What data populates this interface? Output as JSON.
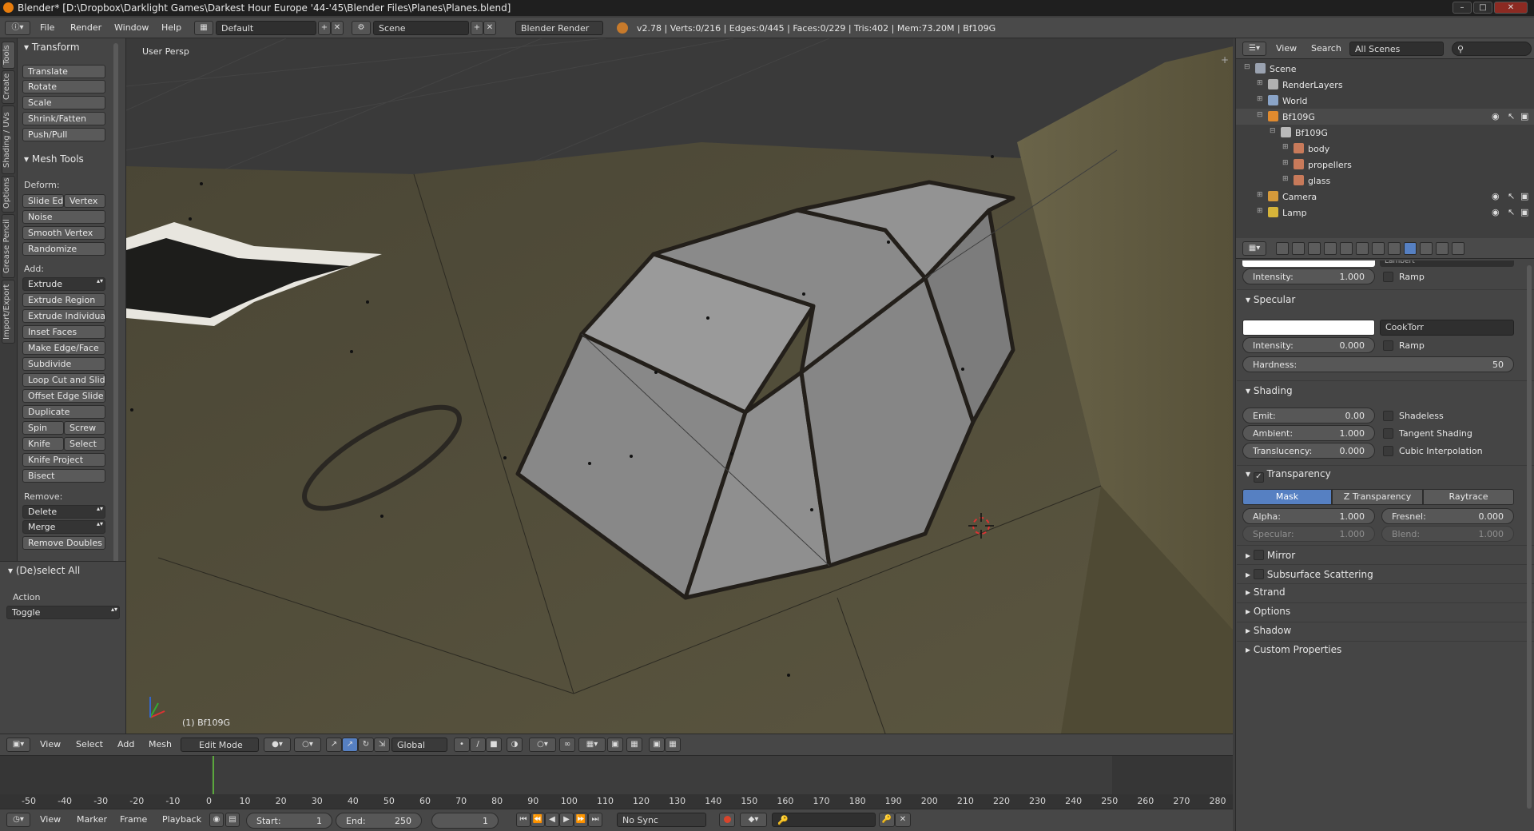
{
  "window": {
    "title": "Blender* [D:\\Dropbox\\Darklight Games\\Darkest Hour Europe '44-'45\\Blender Files\\Planes\\Planes.blend]"
  },
  "infobar": {
    "menus": [
      "File",
      "Render",
      "Window",
      "Help"
    ],
    "layout": "Default",
    "scene": "Scene",
    "engine": "Blender Render",
    "stats": "v2.78 | Verts:0/216 | Edges:0/445 | Faces:0/229 | Tris:402 | Mem:73.20M | Bf109G"
  },
  "toolshelf": {
    "tabs": [
      "Tools",
      "Create",
      "Shading / UVs",
      "Options",
      "Grease Pencil",
      "Import/Export"
    ],
    "transform": {
      "title": "Transform",
      "buttons": [
        "Translate",
        "Rotate",
        "Scale",
        "Shrink/Fatten",
        "Push/Pull"
      ]
    },
    "mesh_tools": {
      "title": "Mesh Tools",
      "deform_label": "Deform:",
      "slide_edge": "Slide Ed",
      "vertex": "Vertex",
      "deform_buttons": [
        "Noise",
        "Smooth Vertex",
        "Randomize"
      ],
      "add_label": "Add:",
      "extrude": "Extrude",
      "add_buttons": [
        "Extrude Region",
        "Extrude Individual",
        "Inset Faces",
        "Make Edge/Face",
        "Subdivide",
        "Loop Cut and Slide",
        "Offset Edge Slide",
        "Duplicate"
      ],
      "spin": "Spin",
      "screw": "Screw",
      "knife": "Knife",
      "select": "Select",
      "knife_project": "Knife Project",
      "bisect": "Bisect",
      "remove_label": "Remove:",
      "delete": "Delete",
      "merge": "Merge",
      "remove_doubles": "Remove Doubles"
    },
    "operator": {
      "title": "(De)select All",
      "action_label": "Action",
      "action_value": "Toggle"
    }
  },
  "viewport": {
    "label": "User Persp",
    "object_label": "(1) Bf109G"
  },
  "view3d_header": {
    "menus": [
      "View",
      "Select",
      "Add",
      "Mesh"
    ],
    "mode": "Edit Mode",
    "orientation": "Global"
  },
  "timeline": {
    "ticks": [
      "-50",
      "-40",
      "-30",
      "-20",
      "-10",
      "0",
      "10",
      "20",
      "30",
      "40",
      "50",
      "60",
      "70",
      "80",
      "90",
      "100",
      "110",
      "120",
      "130",
      "140",
      "150",
      "160",
      "170",
      "180",
      "190",
      "200",
      "210",
      "220",
      "230",
      "240",
      "250",
      "260",
      "270",
      "280"
    ],
    "current_frame_value": 1,
    "header_menus": [
      "View",
      "Marker",
      "Frame",
      "Playback"
    ],
    "start_label": "Start:",
    "start_value": "1",
    "end_label": "End:",
    "end_value": "250",
    "current_frame": "1",
    "sync": "No Sync"
  },
  "outliner": {
    "menus": [
      "View",
      "Search"
    ],
    "filter": "All Scenes",
    "items": [
      {
        "label": "Scene",
        "icon": "scene-icon",
        "indent": 0
      },
      {
        "label": "RenderLayers",
        "icon": "renderlayers-icon",
        "indent": 1
      },
      {
        "label": "World",
        "icon": "world-icon",
        "indent": 1
      },
      {
        "label": "Bf109G",
        "icon": "mesh-object-icon",
        "indent": 1
      },
      {
        "label": "Bf109G",
        "icon": "mesh-data-icon",
        "indent": 2
      },
      {
        "label": "body",
        "icon": "material-icon",
        "indent": 3
      },
      {
        "label": "propellers",
        "icon": "material-icon",
        "indent": 3
      },
      {
        "label": "glass",
        "icon": "material-icon",
        "indent": 3
      },
      {
        "label": "Camera",
        "icon": "camera-icon",
        "indent": 1
      },
      {
        "label": "Lamp",
        "icon": "lamp-icon",
        "indent": 1
      }
    ]
  },
  "properties": {
    "diffuse": {
      "shader": "Lambert",
      "intensity_label": "Intensity:",
      "intensity": "1.000",
      "ramp": "Ramp"
    },
    "specular": {
      "title": "Specular",
      "shader": "CookTorr",
      "intensity_label": "Intensity:",
      "intensity": "0.000",
      "ramp": "Ramp",
      "hardness_label": "Hardness:",
      "hardness": "50"
    },
    "shading": {
      "title": "Shading",
      "emit_label": "Emit:",
      "emit": "0.00",
      "ambient_label": "Ambient:",
      "ambient": "1.000",
      "translucency_label": "Translucency:",
      "translucency": "0.000",
      "shadeless": "Shadeless",
      "tangent": "Tangent Shading",
      "cubic": "Cubic Interpolation"
    },
    "transparency": {
      "title": "Transparency",
      "modes": [
        "Mask",
        "Z Transparency",
        "Raytrace"
      ],
      "alpha_label": "Alpha:",
      "alpha": "1.000",
      "fresnel_label": "Fresnel:",
      "fresnel": "0.000",
      "specular_label": "Specular:",
      "specular": "1.000",
      "blend_label": "Blend:",
      "blend": "1.000"
    },
    "collapsed": [
      "Mirror",
      "Subsurface Scattering",
      "Strand",
      "Options",
      "Shadow",
      "Custom Properties"
    ]
  },
  "colors": {
    "accent": "#5680c2",
    "frame_marker": "#5aa73c",
    "diffuse_swatch": "#ffffff",
    "specular_swatch": "#ffffff"
  }
}
